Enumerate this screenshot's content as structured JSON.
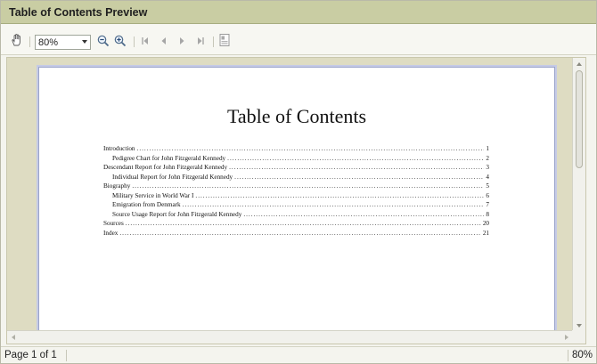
{
  "window": {
    "title": "Table of Contents Preview"
  },
  "toolbar": {
    "zoom_value": "80%",
    "icons": [
      "hand-icon",
      "zoom-out-icon",
      "zoom-in-icon",
      "first-page-icon",
      "previous-page-icon",
      "next-page-icon",
      "last-page-icon",
      "page-layout-icon"
    ]
  },
  "document": {
    "title": "Table of Contents",
    "entries": [
      {
        "label": "Introduction",
        "page": "1",
        "indent": false
      },
      {
        "label": "Pedigree Chart for John Fitzgerald Kennedy",
        "page": "2",
        "indent": true
      },
      {
        "label": "Descendant Report for John Fitzgerald Kennedy",
        "page": "3",
        "indent": false
      },
      {
        "label": "Individual Report for John Fitzgerald Kennedy",
        "page": "4",
        "indent": true
      },
      {
        "label": "Biography",
        "page": "5",
        "indent": false
      },
      {
        "label": "Military Service in World War I",
        "page": "6",
        "indent": true
      },
      {
        "label": "Emigration from Denmark",
        "page": "7",
        "indent": true
      },
      {
        "label": "Source Usage Report for John Fitzgerald Kennedy",
        "page": "8",
        "indent": true
      },
      {
        "label": "Sources",
        "page": "20",
        "indent": false
      },
      {
        "label": "Index",
        "page": "21",
        "indent": false
      }
    ]
  },
  "status": {
    "page_info": "Page 1 of 1",
    "zoom": "80%"
  }
}
